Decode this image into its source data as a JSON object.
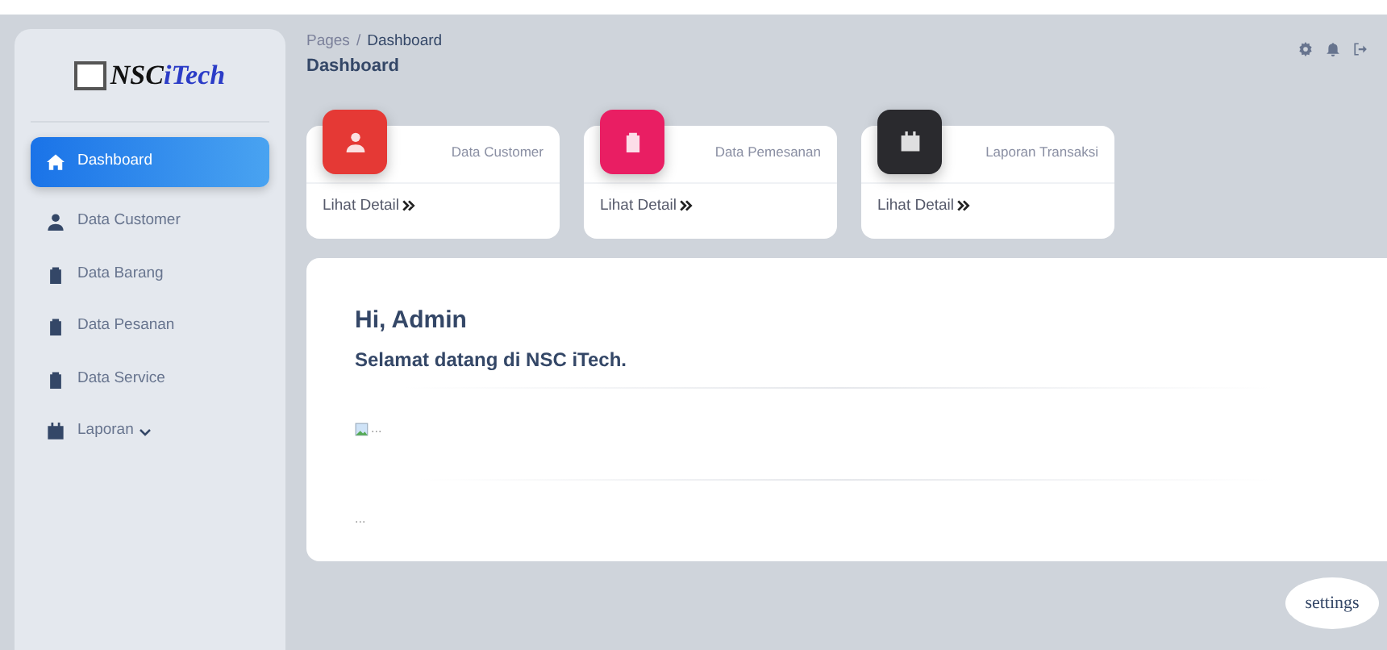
{
  "logo": {
    "brand": "NSC",
    "suffix": "iTech"
  },
  "sidebar": {
    "items": [
      {
        "label": "Dashboard",
        "selected": true,
        "kind": "link"
      },
      {
        "label": "Data Customer",
        "selected": false,
        "kind": "link"
      },
      {
        "label": "Data Barang",
        "selected": false,
        "kind": "link"
      },
      {
        "label": "Data Pesanan",
        "selected": false,
        "kind": "link"
      },
      {
        "label": "Data Service",
        "selected": false,
        "kind": "link"
      },
      {
        "label": "Laporan",
        "selected": false,
        "kind": "dropdown"
      }
    ]
  },
  "breadcrumb": {
    "items": [
      "Pages",
      "Dashboard"
    ],
    "separator": "/"
  },
  "page_title": "Dashboard",
  "cards": [
    {
      "title": "Data Customer",
      "link": "Lihat Detail",
      "color": "#e53935"
    },
    {
      "title": "Data Pemesanan",
      "link": "Lihat Detail",
      "color": "#e91e63"
    },
    {
      "title": "Laporan Transaksi",
      "link": "Lihat Detail",
      "color": "#2a2a2e"
    }
  ],
  "welcome": {
    "greeting": "Hi, Admin",
    "message": "Selamat datang di NSC iTech.",
    "image_alt": "...",
    "footer": "..."
  },
  "settings_button": "settings"
}
